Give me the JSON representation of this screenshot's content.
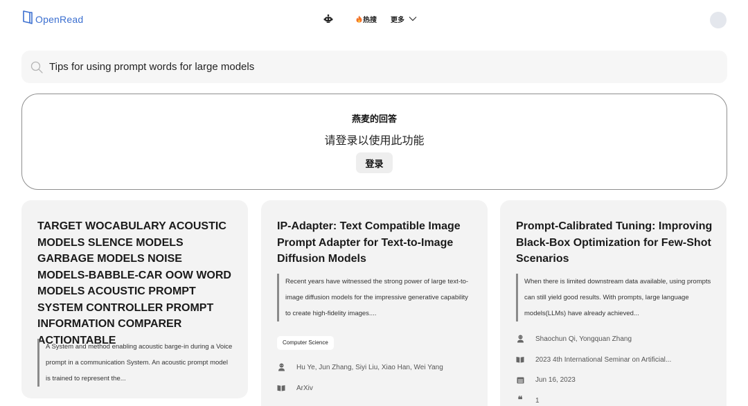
{
  "header": {
    "logo_text": "OpenRead",
    "nav": {
      "bot_icon": "robot-icon",
      "hot_icon": "fire-emoji",
      "hot_label": "热搜",
      "more_label": "更多"
    }
  },
  "search": {
    "value": "Tips for using prompt words for large models"
  },
  "answer": {
    "title": "燕麦的回答",
    "message": "请登录以使用此功能",
    "login_label": "登录"
  },
  "cards": [
    {
      "title": "TARGET WOCABULARY ACOUSTIC MODELS SLENCE MODELS GARBAGE MODELS NOISE MODELS-BABBLE-CAR OOW WORD MODELS ACOUSTIC PROMPT SYSTEM CONTROLLER PROMPT INFORMATION COMPARER ACTIONTABLE",
      "abstract": "A System and method enabling acoustic barge-in during a Voice prompt in a communication System. An acoustic prompt model is trained to represent the..."
    },
    {
      "title": "IP-Adapter: Text Compatible Image Prompt Adapter for Text-to-Image Diffusion Models",
      "abstract": "Recent years have witnessed the strong power of large text-to-image diffusion models for the impressive generative capability to create high-fidelity images....",
      "tag": "Computer Science",
      "authors": "Hu Ye, Jun Zhang, Siyi Liu, Xiao Han, Wei Yang",
      "venue": "ArXiv"
    },
    {
      "title": "Prompt-Calibrated Tuning: Improving Black-Box Optimization for Few-Shot Scenarios",
      "abstract": "When there is limited downstream data available, using prompts can still yield good results. With prompts, large language models(LLMs) have already achieved...",
      "authors": "Shaochun Qi, Yongquan Zhang",
      "venue": "2023 4th International Seminar on Artificial...",
      "date": "Jun 16, 2023",
      "citations": "1"
    }
  ],
  "colors": {
    "brand": "#3b6fd0",
    "card_bg": "#f3f3f3",
    "search_bg": "#f6f6f6",
    "avatar_bg": "#e4e7ed"
  }
}
